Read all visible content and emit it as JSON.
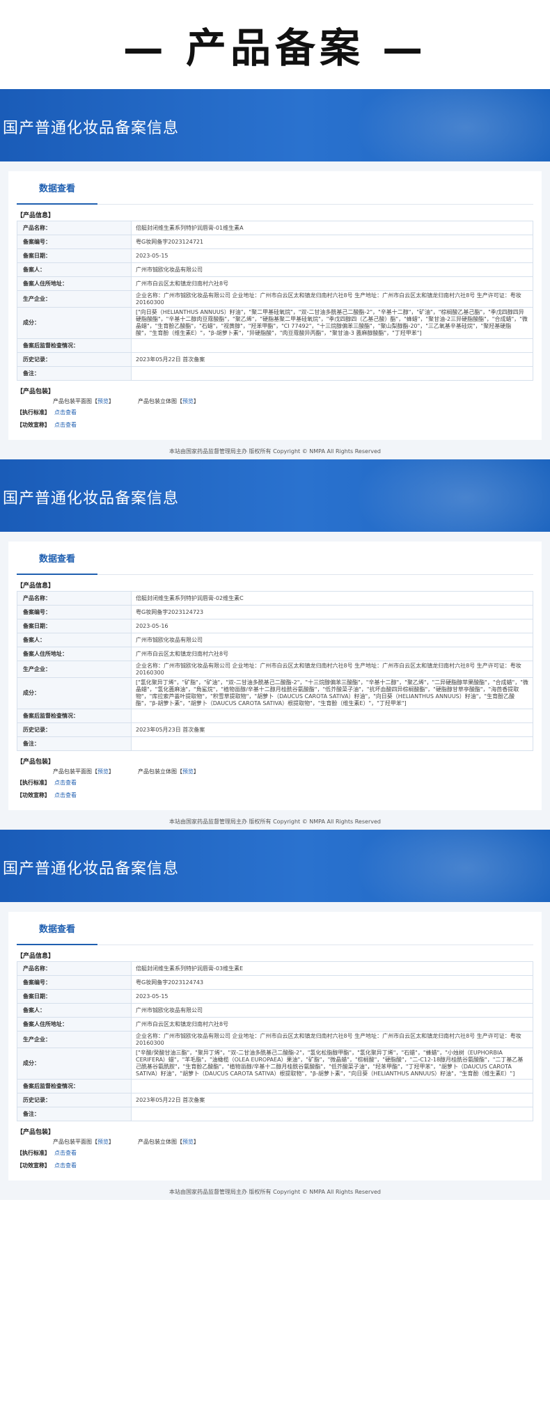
{
  "page_title": "— 产品备案 —",
  "banner_title": "国产普通化妆品备案信息",
  "tab_label": "数据查看",
  "labels": {
    "product_info": "【产品信息】",
    "product_name": "产品名称：",
    "record_no": "备案编号：",
    "record_date": "备案日期：",
    "filer": "备案人：",
    "filer_address": "备案人住所地址：",
    "manufacturer": "生产企业：",
    "ingredients": "成分：",
    "post_inspection": "备案后监督检查情况：",
    "history": "历史记录：",
    "remarks": "备注：",
    "packaging": "【产品包装】",
    "flat_pkg": "产品包装平面图",
    "solid_pkg": "产品包装立体图",
    "preview": "预览",
    "bracket_open": "【",
    "bracket_close": "】",
    "standard": "【执行标准】",
    "efficacy": "【功效宣称】",
    "click_view": "点击查看"
  },
  "footer": "本站由国家药品监督管理局主办 版权所有 Copyright © NMPA All Rights Reserved",
  "records": [
    {
      "product_name": "倍艇封闭维生素系列特护润唇膏-01维生素A",
      "record_no": "粤G妆网备字2023124721",
      "record_date": "2023-05-15",
      "filer": "广州市铖欧化妆品有限公司",
      "filer_address": "广州市白云区太和镇龙归南村六社8号",
      "manufacturer": "企业名称：广州市铖欧化妆品有限公司 企业地址：广州市白云区太和镇龙归南村六社8号 生产地址：广州市白云区太和镇龙归南村六社8号 生产许可证：粤妆20160300",
      "ingredients": "[\"向日葵（HELIANTHUS ANNUUS）籽油\"，\"聚二甲基硅氧烷\"，\"双-二甘油多酰基己二酸酯-2\"，\"辛基十二醇\"，\"矿油\"，\"棕榈酸乙基己酯\"，\"季戊四醇四异硬脂酸酯\"，\"辛基十二醇肉豆蔻酸酯\"，\"聚乙烯\"，\"硬脂基聚二甲基硅氧烷\"，\"季戊四醇四（乙基己酸）酯\"，\"蜂蜡\"，\"聚甘油-2三异硬脂酸酯\"，\"合成蜡\"，\"微晶蜡\"，\"生育酚乙酸酯\"，\"石蜡\"，\"视黄醇\"，\"羟苯甲酯\"，\"CI 77492\"，\"十三烷醇偏苯三酸酯\"，\"聚山梨醇酯-20\"，\"三乙氧基辛基硅烷\"，\"聚羟基硬脂酸\"，\"生育酚（维生素E）\"，\"β-胡萝卜素\"，\"异硬脂酸\"，\"肉豆蔻酸异丙酯\"，\"聚甘油-3 蓖麻醇酸酯\"，\"丁羟甲苯\"]",
      "post_inspection": "",
      "history": "2023年05月22日 首次备案",
      "remarks": ""
    },
    {
      "product_name": "倍艇封闭维生素系列特护润唇膏-02维生素C",
      "record_no": "粤G妆网备字2023124723",
      "record_date": "2023-05-16",
      "filer": "广州市铖欧化妆品有限公司",
      "filer_address": "广州市白云区太和镇龙归南村六社8号",
      "manufacturer": "企业名称：广州市铖欧化妆品有限公司 企业地址：广州市白云区太和镇龙归南村六社8号 生产地址：广州市白云区太和镇龙归南村六社8号 生产许可证：粤妆20160300",
      "ingredients": "[\"氢化聚异丁烯\"，\"矿脂\"，\"矿油\"，\"双-二甘油多酰基己二酸酯-2\"，\"十三烷醇偏苯三酸酯\"，\"辛基十二醇\"，\"聚乙烯\"，\"二异硬脂醇苹果酸酯\"，\"合成蜡\"，\"微晶蜡\"，\"氢化蓖麻油\"，\"角鲨烷\"，\"植物甾醇/辛基十二醇月桂酰谷氨酸酯\"，\"低芥酸菜子油\"，\"抗坏血酸四异棕榈酸酯\"，\"硬脂醇甘草亭酸酯\"，\"海茴香提取物\"，\"库拉索芦荟叶提取物\"，\"积雪草提取物\"，\"胡萝卜（DAUCUS CAROTA SATIVA）籽油\"，\"向日葵（HELIANTHUS ANNUUS）籽油\"，\"生育酚乙酸酯\"，\"β-胡萝卜素\"，\"胡萝卜（DAUCUS CAROTA SATIVA）根提取物\"，\"生育酚（维生素E）\"，\"丁羟甲苯\"]",
      "post_inspection": "",
      "history": "2023年05月23日 首次备案",
      "remarks": ""
    },
    {
      "product_name": "倍艇封闭维生素系列特护润唇膏-03维生素E",
      "record_no": "粤G妆网备字2023124743",
      "record_date": "2023-05-15",
      "filer": "广州市铖欧化妆品有限公司",
      "filer_address": "广州市白云区太和镇龙归南村六社8号",
      "manufacturer": "企业名称：广州市铖欧化妆品有限公司 企业地址：广州市白云区太和镇龙归南村六社8号 生产地址：广州市白云区太和镇龙归南村六社8号 生产许可证：粤妆20160300",
      "ingredients": "[\"辛酸/癸酸甘油三酯\"，\"聚异丁烯\"，\"双-二甘油多酰基己二酸酯-2\"，\"氢化松脂醇甲酯\"，\"氢化聚异丁烯\"，\"石蜡\"，\"蜂蜡\"，\"小烛树（EUPHORBIA CERIFERA）蜡\"，\"羊毛脂\"，\"油橄榄（OLEA EUROPAEA）果油\"，\"矿脂\"，\"微晶蜡\"，\"棕榈酸\"，\"硬脂酸\"，\"二-C12-18醇月桂酰谷氨酸酯\"，\"二丁基乙基己酰基谷氨酰胺\"，\"生育酚乙酸酯\"，\"植物甾醇/辛基十二醇月桂酰谷氨酸酯\"，\"低芥酸菜子油\"，\"羟苯甲酯\"，\"丁羟甲苯\"，\"胡萝卜（DAUCUS CAROTA SATIVA）籽油\"，\"胡萝卜（DAUCUS CAROTA SATIVA）根提取物\"，\"β-胡萝卜素\"，\"向日葵（HELIANTHUS ANNUUS）籽油\"，\"生育酚（维生素E）\"]",
      "post_inspection": "",
      "history": "2023年05月22日 首次备案",
      "remarks": ""
    }
  ]
}
